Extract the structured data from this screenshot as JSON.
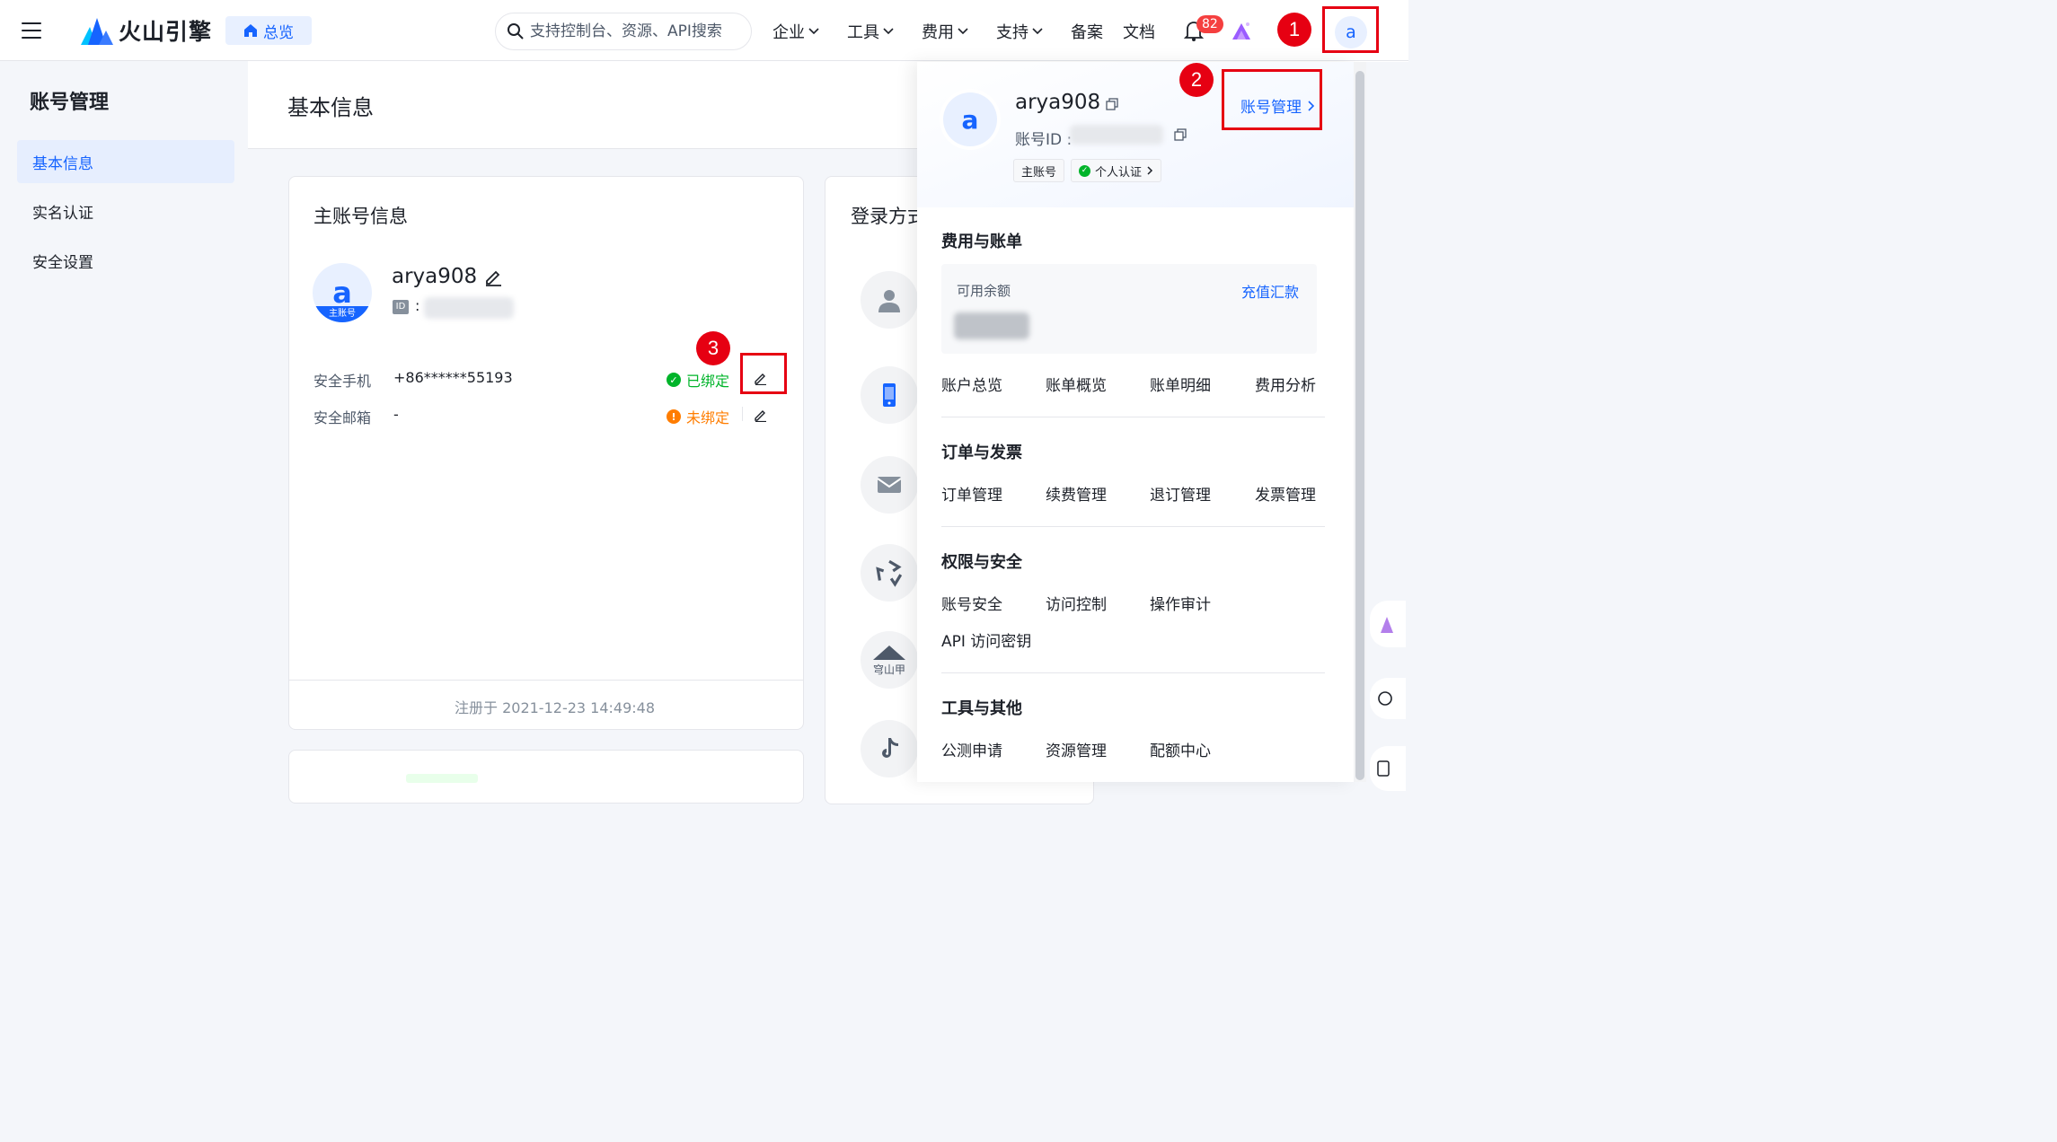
{
  "topbar": {
    "brand": "火山引擎",
    "overview_label": "总览",
    "search_placeholder": "支持控制台、资源、API搜索",
    "nav": [
      "企业",
      "工具",
      "费用",
      "支持",
      "备案",
      "文档"
    ],
    "notification_count": "82",
    "avatar_letter": "a"
  },
  "annotations": [
    "1",
    "2",
    "3"
  ],
  "sidebar": {
    "title": "账号管理",
    "items": [
      "基本信息",
      "实名认证",
      "安全设置"
    ]
  },
  "main": {
    "title": "基本信息",
    "account_card": {
      "title": "主账号信息",
      "avatar_letter": "a",
      "avatar_tag": "主账号",
      "username": "arya908",
      "id_badge": "ID",
      "id_sep": ":",
      "phone_label": "安全手机",
      "phone_value": "+86******55193",
      "phone_status": "已绑定",
      "email_label": "安全邮箱",
      "email_value": "-",
      "email_status": "未绑定",
      "registered": "注册于 2021-12-23 14:49:48"
    },
    "login_card": {
      "title": "登录方式"
    },
    "login_icon_caption": "穹山甲"
  },
  "panel": {
    "avatar_letter": "a",
    "username": "arya908",
    "account_id_label": "账号ID :",
    "account_mgmt_link": "账号管理",
    "pill_main": "主账号",
    "pill_cert": "个人认证",
    "sections": {
      "billing": {
        "title": "费用与账单",
        "balance_label": "可用余额",
        "recharge": "充值汇款",
        "links": [
          "账户总览",
          "账单概览",
          "账单明细",
          "费用分析"
        ]
      },
      "orders": {
        "title": "订单与发票",
        "links": [
          "订单管理",
          "续费管理",
          "退订管理",
          "发票管理"
        ]
      },
      "security": {
        "title": "权限与安全",
        "links": [
          "账号安全",
          "访问控制",
          "操作审计",
          "API 访问密钥"
        ]
      },
      "tools": {
        "title": "工具与其他",
        "links": [
          "公测申请",
          "资源管理",
          "配额中心"
        ]
      }
    }
  },
  "colors": {
    "accent": "#1664ff",
    "success": "#00b42a",
    "warning": "#ff7d00",
    "annotation": "#e60012"
  }
}
